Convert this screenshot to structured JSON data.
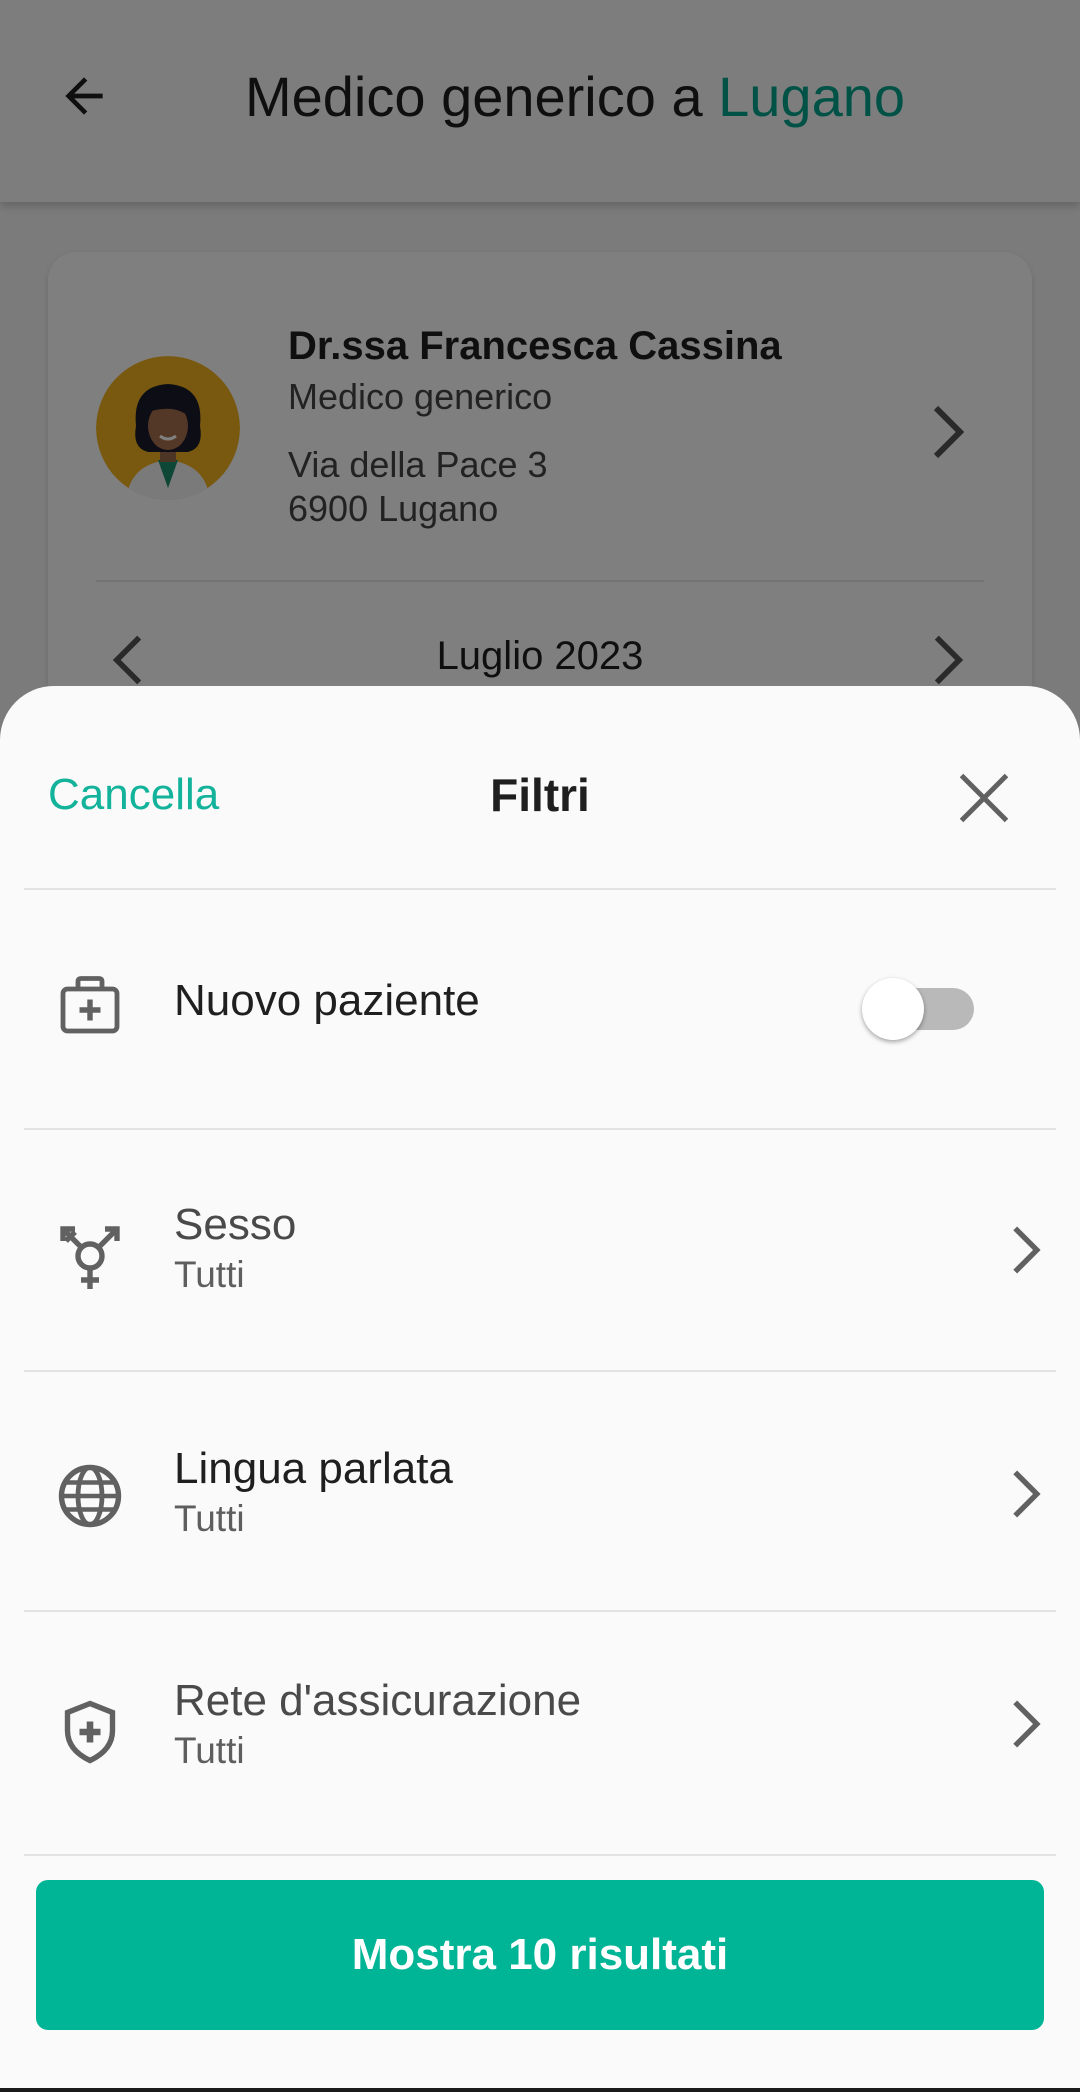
{
  "header": {
    "title_prefix": "Medico generico a ",
    "title_city": "Lugano"
  },
  "doctor_card": {
    "name": "Dr.ssa Francesca Cassina",
    "specialty": "Medico generico",
    "address_line1": "Via della Pace 3",
    "address_line2": "6900 Lugano",
    "month": "Luglio 2023"
  },
  "sheet": {
    "cancel_label": "Cancella",
    "title": "Filtri",
    "filters": [
      {
        "icon": "medical-kit-icon",
        "label": "Nuovo paziente",
        "type": "toggle",
        "enabled": false
      },
      {
        "icon": "gender-icon",
        "label": "Sesso",
        "value": "Tutti"
      },
      {
        "icon": "globe-icon",
        "label": "Lingua parlata",
        "value": "Tutti"
      },
      {
        "icon": "shield-plus-icon",
        "label": "Rete d'assicurazione",
        "value": "Tutti"
      }
    ],
    "cta_label": "Mostra 10 risultati"
  },
  "colors": {
    "accent": "#00b496",
    "accent_text": "#12b39a",
    "city": "#00a58c"
  }
}
